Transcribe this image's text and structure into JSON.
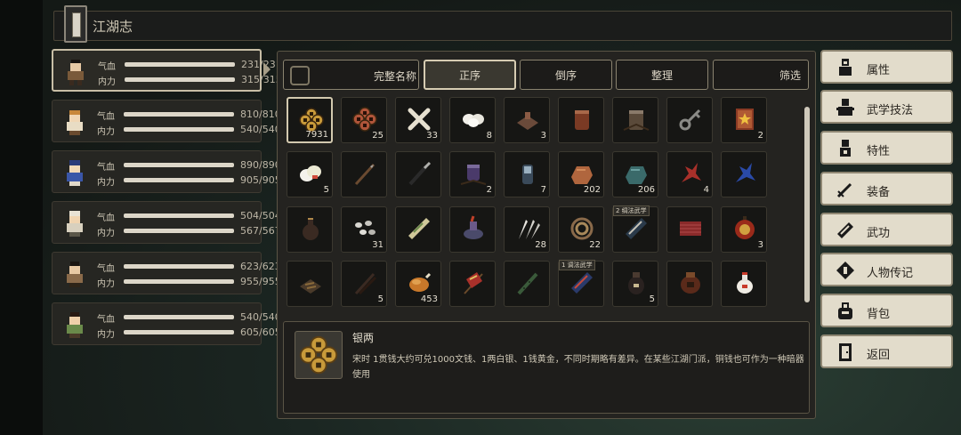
{
  "header": {
    "title": "江湖志"
  },
  "characters": [
    {
      "hp_label": "气血",
      "mp_label": "内力",
      "hp": "231/231",
      "mp": "315/315"
    },
    {
      "hp_label": "气血",
      "mp_label": "内力",
      "hp": "810/810",
      "mp": "540/540"
    },
    {
      "hp_label": "气血",
      "mp_label": "内力",
      "hp": "890/890",
      "mp": "905/905"
    },
    {
      "hp_label": "气血",
      "mp_label": "内力",
      "hp": "504/504",
      "mp": "567/567"
    },
    {
      "hp_label": "气血",
      "mp_label": "内力",
      "hp": "623/623",
      "mp": "955/955"
    },
    {
      "hp_label": "气血",
      "mp_label": "内力",
      "hp": "540/540",
      "mp": "605/605"
    }
  ],
  "toolbar": {
    "fullname": "完整名称",
    "ascending": "正序",
    "descending": "倒序",
    "organize": "整理",
    "filter": "筛选"
  },
  "inventory": [
    {
      "icon": "coins-gold-icon",
      "count": "7931"
    },
    {
      "icon": "coins-copper-icon",
      "count": "25"
    },
    {
      "icon": "bone-icon",
      "count": "33"
    },
    {
      "icon": "rice-balls-icon",
      "count": "8"
    },
    {
      "icon": "stone-block-icon",
      "count": "3"
    },
    {
      "icon": "clay-jar-icon",
      "count": ""
    },
    {
      "icon": "wooden-bucket-icon",
      "count": ""
    },
    {
      "icon": "key-icon",
      "count": ""
    },
    {
      "icon": "scroll-book-icon",
      "count": "2"
    },
    {
      "icon": "steamed-buns-icon",
      "count": "5"
    },
    {
      "icon": "spear-icon",
      "count": ""
    },
    {
      "icon": "dagger-icon",
      "count": ""
    },
    {
      "icon": "purple-jar-icon",
      "count": "2"
    },
    {
      "icon": "glass-bottle-icon",
      "count": "7"
    },
    {
      "icon": "copper-ore-icon",
      "count": "202"
    },
    {
      "icon": "jade-ore-icon",
      "count": "206"
    },
    {
      "icon": "red-herb-icon",
      "count": "4"
    },
    {
      "icon": "blue-herb-icon",
      "count": ""
    },
    {
      "icon": "wine-gourd-icon",
      "count": ""
    },
    {
      "icon": "pebbles-icon",
      "count": "31"
    },
    {
      "icon": "talisman-icon",
      "count": ""
    },
    {
      "icon": "incense-burner-icon",
      "count": ""
    },
    {
      "icon": "feathers-icon",
      "count": "28"
    },
    {
      "icon": "rope-coil-icon",
      "count": "22"
    },
    {
      "icon": "martial-manual-icon",
      "count": "",
      "tag": "2 绸法武学"
    },
    {
      "icon": "red-box-icon",
      "count": ""
    },
    {
      "icon": "lantern-icon",
      "count": "3"
    },
    {
      "icon": "tea-leaves-icon",
      "count": ""
    },
    {
      "icon": "chopsticks-icon",
      "count": "5"
    },
    {
      "icon": "roast-chicken-icon",
      "count": "453"
    },
    {
      "icon": "red-banner-icon",
      "count": ""
    },
    {
      "icon": "bamboo-flute-icon",
      "count": ""
    },
    {
      "icon": "blue-manual-icon",
      "count": "",
      "tag": "1 调法武学"
    },
    {
      "icon": "black-jar-icon",
      "count": "5"
    },
    {
      "icon": "wine-jar-icon",
      "count": ""
    },
    {
      "icon": "medicine-bottle-icon",
      "count": ""
    }
  ],
  "description": {
    "name": "银两",
    "text": "宋时 1贯钱大约可兑1000文钱、1两白银、1钱黄金，不同时期略有差异。在某些江湖门派，铜钱也可作为一种暗器使用"
  },
  "menu": [
    {
      "icon": "attribute-icon",
      "label": "属性"
    },
    {
      "icon": "martial-skill-icon",
      "label": "武学技法"
    },
    {
      "icon": "trait-icon",
      "label": "特性"
    },
    {
      "icon": "sword-icon",
      "label": "装备"
    },
    {
      "icon": "book-icon",
      "label": "武功"
    },
    {
      "icon": "biography-icon",
      "label": "人物传记"
    },
    {
      "icon": "backpack-icon",
      "label": "背包"
    },
    {
      "icon": "door-icon",
      "label": "返回"
    }
  ],
  "colors": {
    "accent": "#d6ccb2",
    "menu_bg": "#e2dccb",
    "panel_bg": "#242320"
  }
}
